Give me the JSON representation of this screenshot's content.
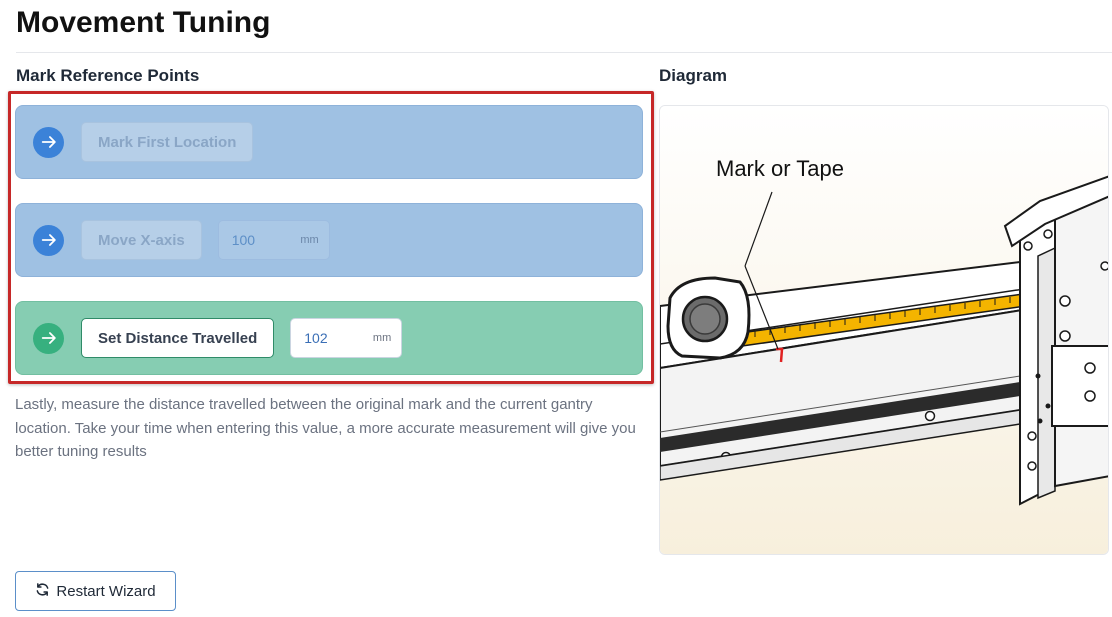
{
  "page": {
    "title": "Movement Tuning"
  },
  "left": {
    "heading": "Mark Reference Points",
    "steps": [
      {
        "icon": "arrow-right-icon",
        "button": "Mark First Location",
        "state": "disabled"
      },
      {
        "icon": "arrow-right-icon",
        "button": "Move X-axis",
        "state": "disabled",
        "input_value": "100",
        "unit": "mm"
      },
      {
        "icon": "arrow-right-icon",
        "button": "Set Distance Travelled",
        "state": "enabled",
        "input_value": "102",
        "unit": "mm"
      }
    ],
    "instructions": "Lastly, measure the distance travelled between the original mark and the current gantry location. Take your time when entering this value, a more accurate measurement will give you better tuning results"
  },
  "right": {
    "heading": "Diagram",
    "diagram_label": "Mark or Tape"
  },
  "footer": {
    "restart_label": "Restart Wizard",
    "restart_icon": "refresh-icon"
  },
  "colors": {
    "highlight_border": "#c62828",
    "inactive_step": "#9fc1e3",
    "active_step": "#86cdb2",
    "inactive_icon": "#3b82d8",
    "active_icon": "#37b07f",
    "tape": "#f4b400"
  }
}
